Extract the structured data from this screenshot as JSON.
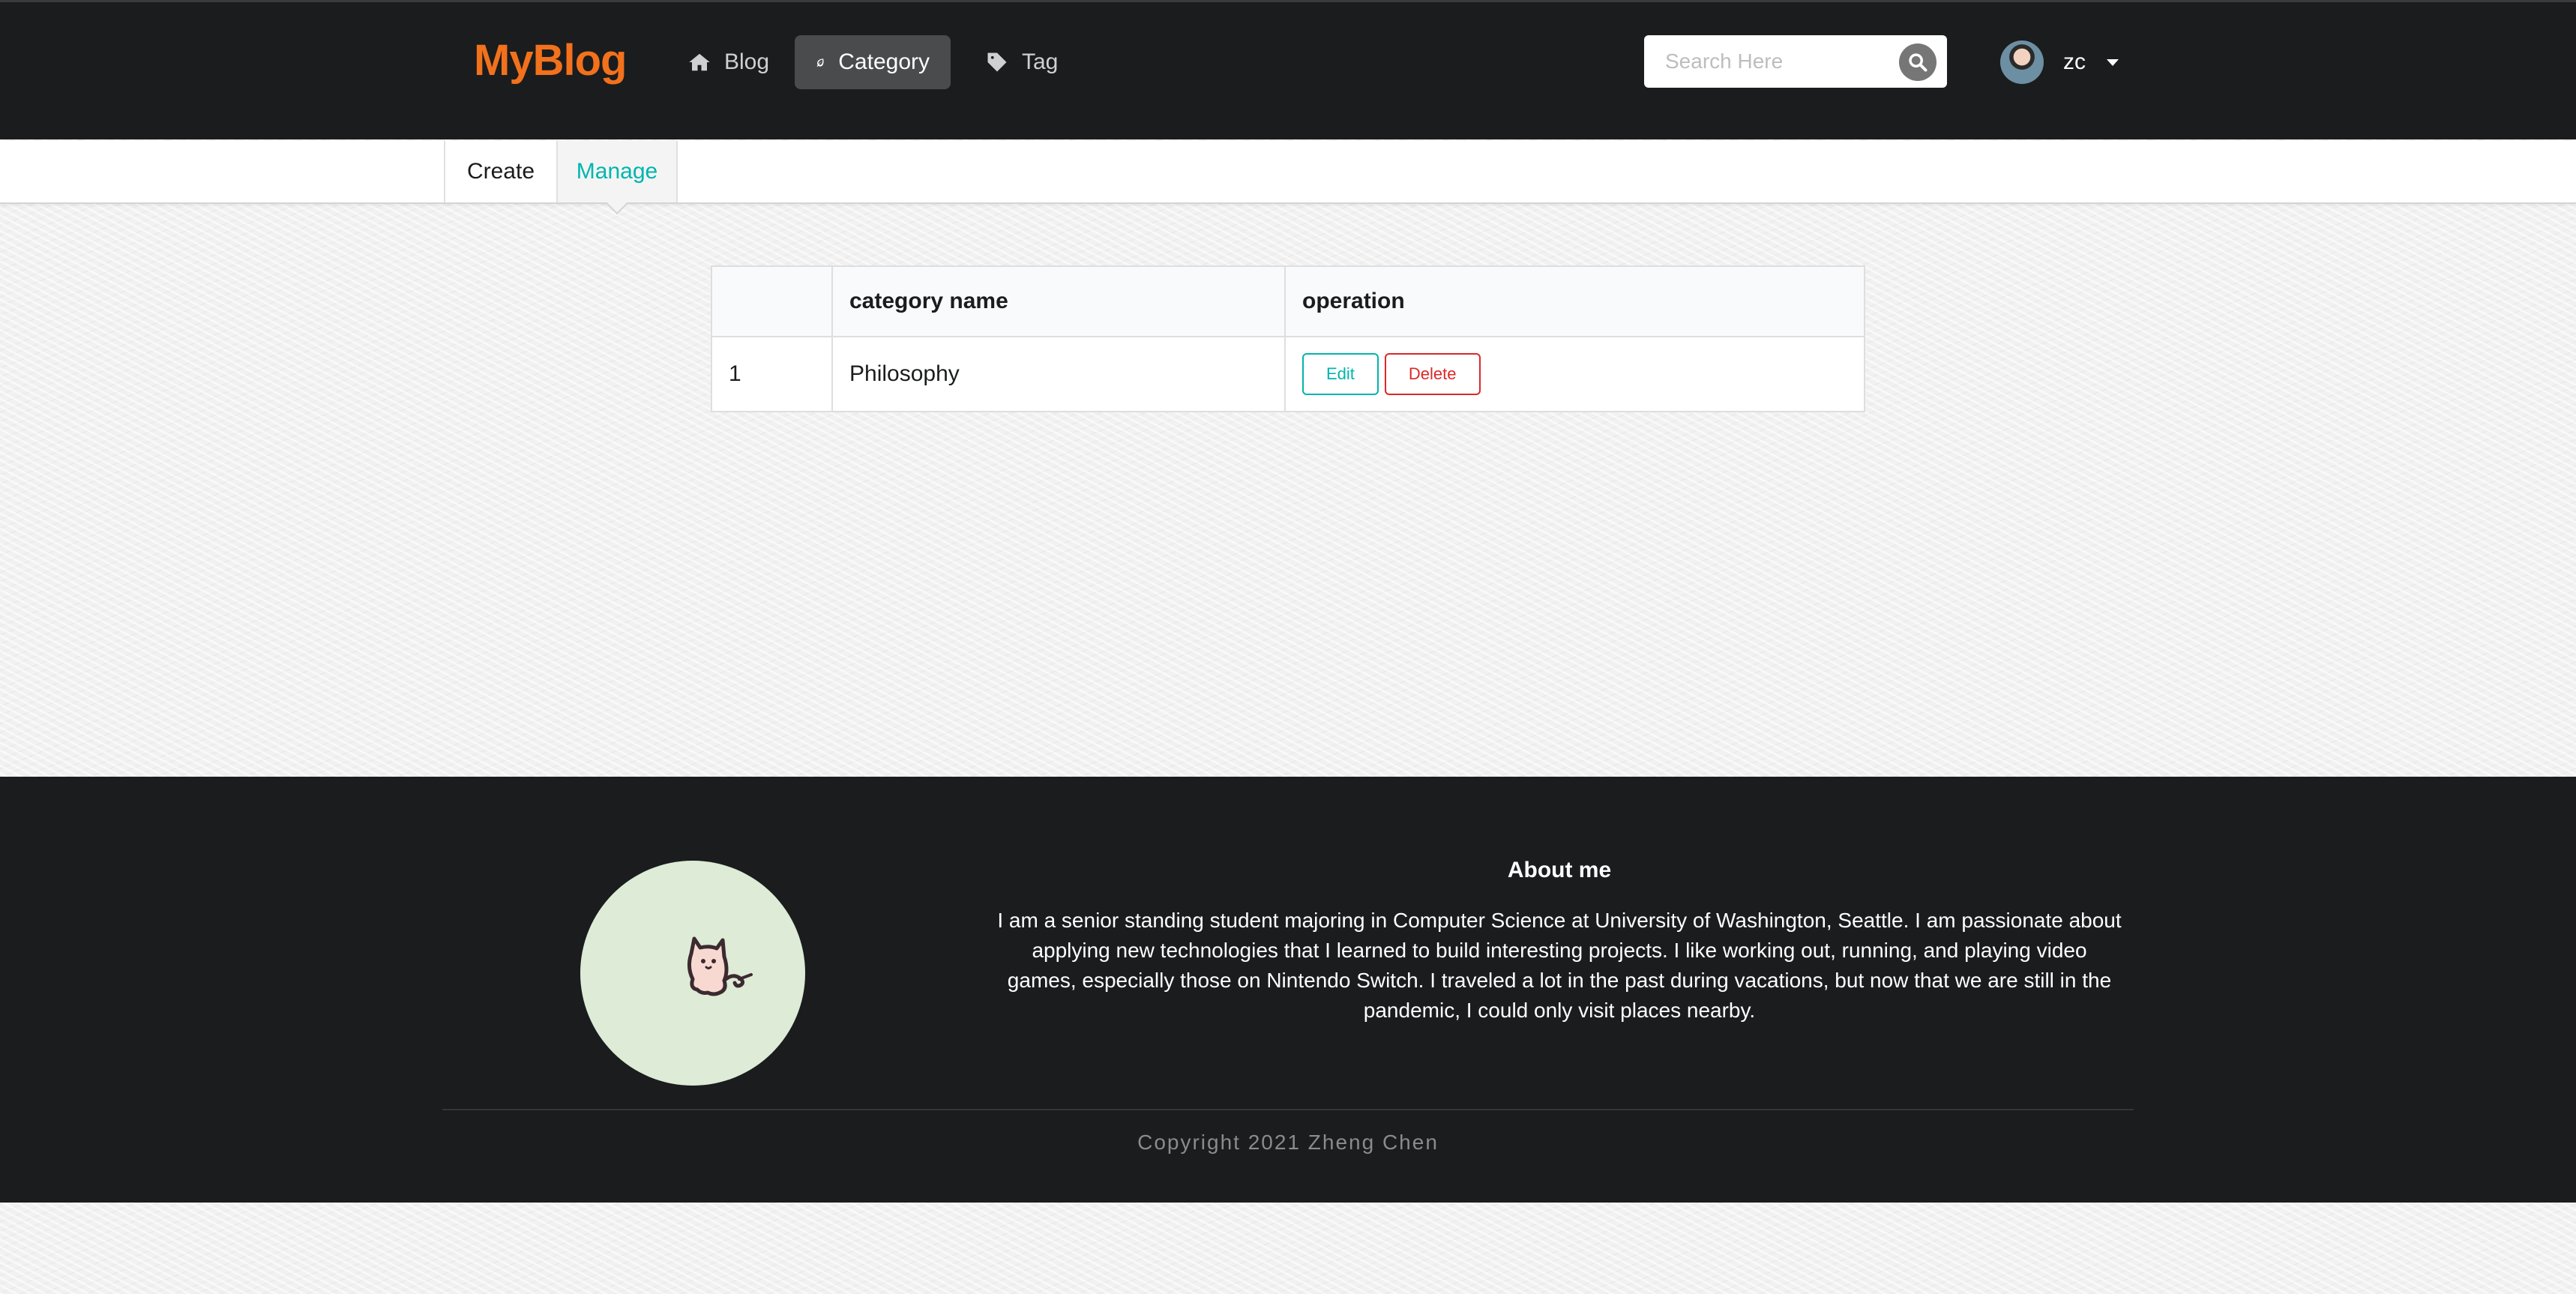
{
  "header": {
    "logo": "MyBlog",
    "nav": [
      {
        "label": "Blog",
        "icon": "home-icon"
      },
      {
        "label": "Category",
        "icon": "leaf-icon",
        "active": true
      },
      {
        "label": "Tag",
        "icon": "tag-icon"
      }
    ],
    "search_placeholder": "Search Here",
    "username": "zc"
  },
  "subnav": {
    "tabs": [
      {
        "label": "Create"
      },
      {
        "label": "Manage",
        "active": true
      }
    ]
  },
  "table": {
    "headers": [
      "",
      "category name",
      "operation"
    ],
    "rows": [
      {
        "index": "1",
        "name": "Philosophy",
        "edit_label": "Edit",
        "delete_label": "Delete"
      }
    ]
  },
  "footer": {
    "about_title": "About me",
    "about_text": "I am a senior standing student majoring in Computer Science at University of Washington, Seattle. I am passionate about applying new technologies that I learned to build interesting projects. I like working out, running, and playing video games, especially those on Nintendo Switch. I traveled a lot in the past during vacations, but now that we are still in the pandemic, I could only visit places nearby.",
    "copyright": "Copyright 2021 Zheng Chen"
  },
  "colors": {
    "brand": "#f2711c",
    "accent": "#00b5ad",
    "danger": "#db2828",
    "dark": "#1b1c1d"
  }
}
